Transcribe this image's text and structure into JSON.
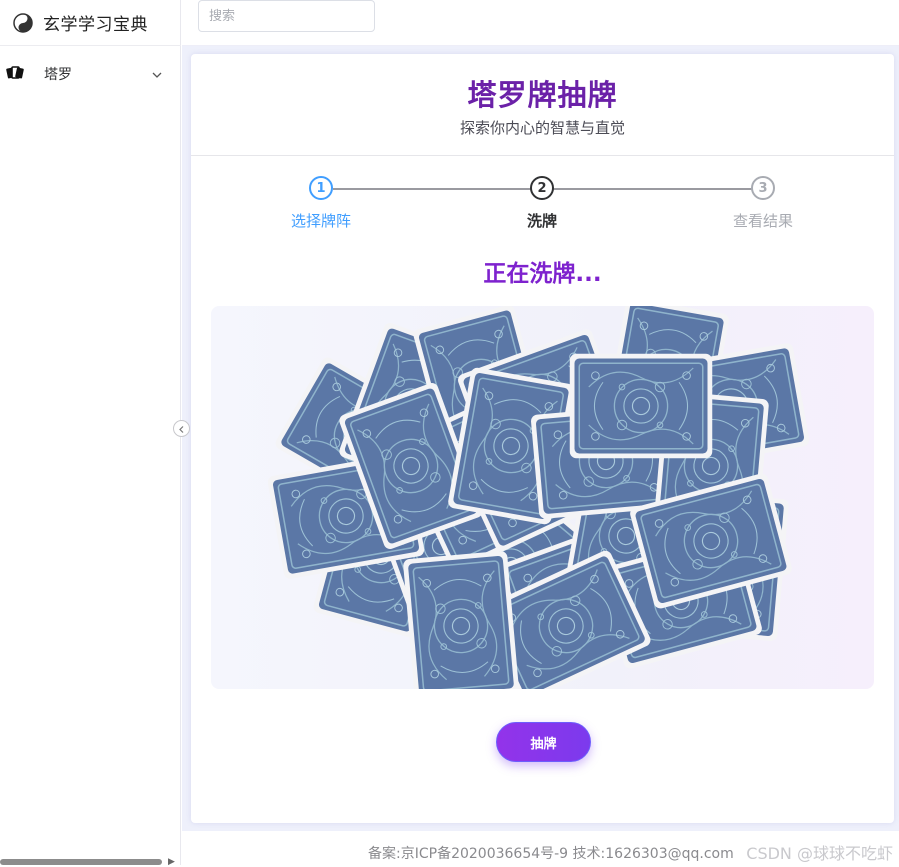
{
  "app": {
    "title": "玄学学习宝典"
  },
  "search": {
    "placeholder": "搜索",
    "value": ""
  },
  "sidebar": {
    "items": [
      {
        "label": "塔罗",
        "icon": "tarot-cards-icon",
        "expandable": true
      }
    ]
  },
  "card": {
    "title": "塔罗牌抽牌",
    "subtitle": "探索你内心的智慧与直觉"
  },
  "steps": [
    {
      "number": "1",
      "label": "选择牌阵",
      "state": "finished"
    },
    {
      "number": "2",
      "label": "洗牌",
      "state": "active"
    },
    {
      "number": "3",
      "label": "查看结果",
      "state": "waiting"
    }
  ],
  "status_text": "正在洗牌...",
  "draw_button": {
    "label": "抽牌"
  },
  "footer": {
    "icp": "备案:京ICP备2020036654号-9 技术:1626303@qq.com",
    "watermark": "CSDN @球球不吃虾"
  },
  "colors": {
    "brand_purple": "#6b21a8",
    "step_finished": "#409eff",
    "step_active": "#303133",
    "step_waiting": "#a8abb2",
    "card_back": "#5b77a6",
    "card_pattern": "#8fb4cc",
    "button_gradient_start": "#9333ea",
    "button_gradient_end": "#7c3aed"
  }
}
